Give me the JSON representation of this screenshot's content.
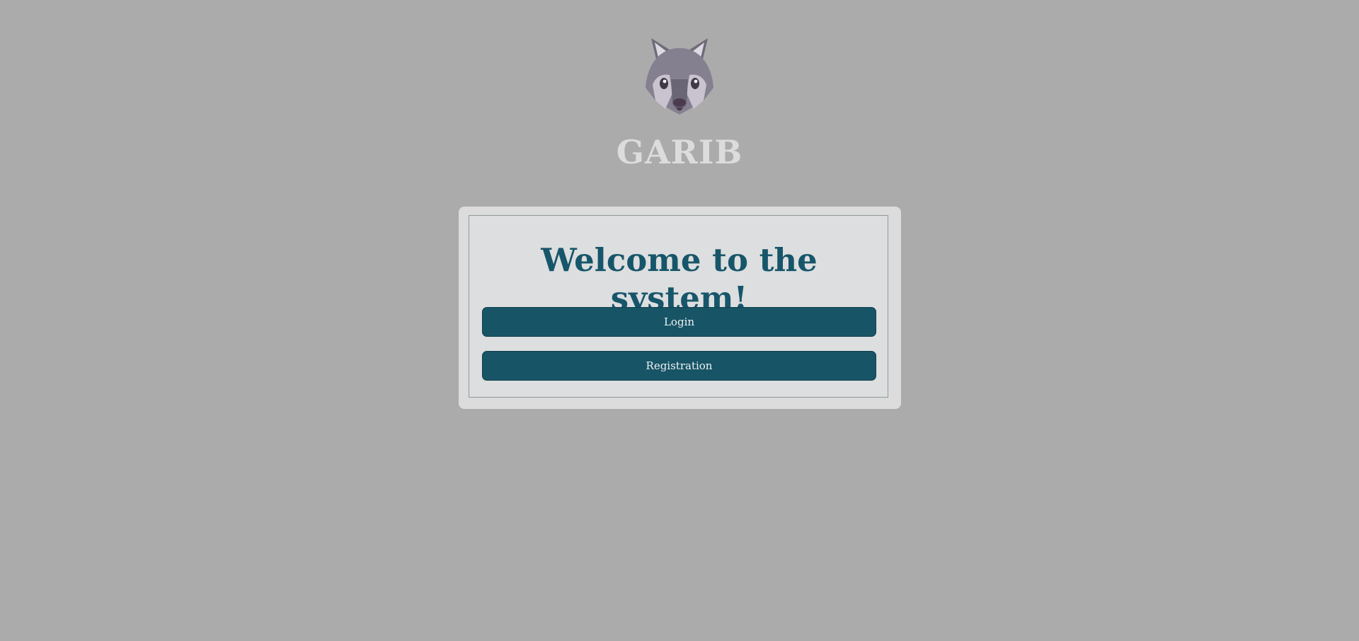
{
  "brand": {
    "name": "GARIB",
    "logo_icon": "wolf-head-icon"
  },
  "welcome_card": {
    "title": "Welcome to the system!",
    "login_label": "Login",
    "registration_label": "Registration"
  },
  "colors": {
    "background": "#ababab",
    "card": "#dcdcdc",
    "accent": "#17566a",
    "brand_text": "#dcdcdc"
  }
}
